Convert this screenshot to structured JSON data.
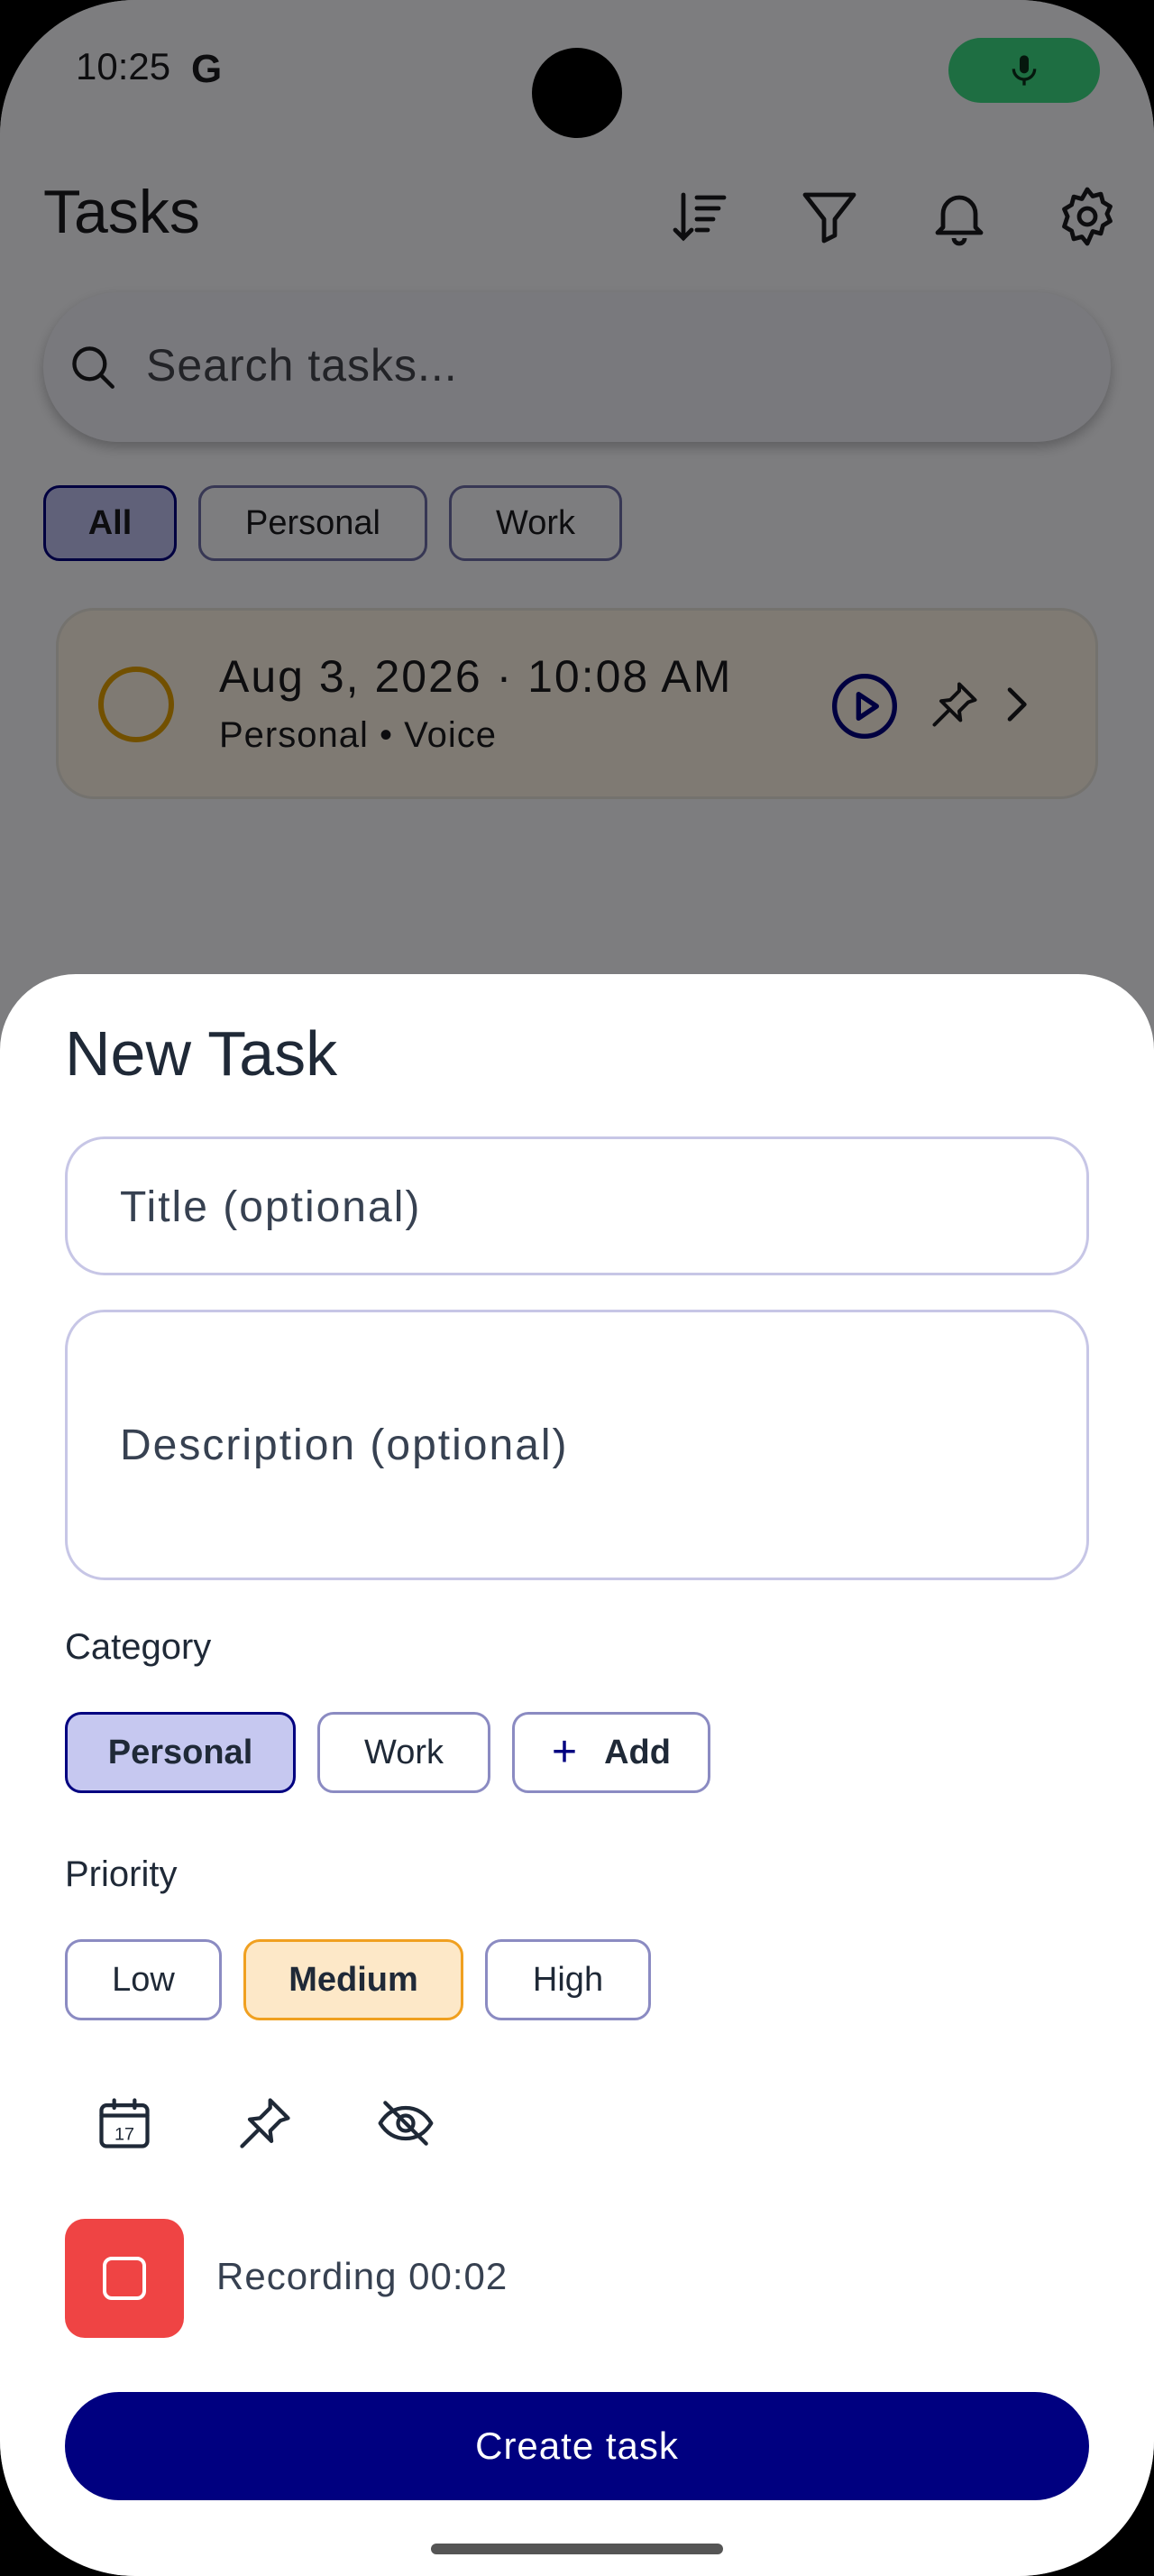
{
  "status_bar": {
    "time": "10:25",
    "g_label": "G"
  },
  "app_bar": {
    "title": "Tasks",
    "icons": [
      "sort-icon",
      "filter-icon",
      "bell-icon",
      "settings-icon"
    ]
  },
  "search": {
    "placeholder": "Search tasks..."
  },
  "filters": [
    {
      "label": "All",
      "selected": true
    },
    {
      "label": "Personal",
      "selected": false
    },
    {
      "label": "Work",
      "selected": false
    }
  ],
  "task": {
    "title": "Aug 3, 2026 · 10:08 AM",
    "meta": "Personal • Voice"
  },
  "sheet": {
    "heading": "New Task",
    "title_placeholder": "Title (optional)",
    "description_placeholder": "Description (optional)",
    "category_label": "Category",
    "categories": [
      {
        "label": "Personal",
        "selected": true
      },
      {
        "label": "Work",
        "selected": false
      }
    ],
    "add_label": "Add",
    "priority_label": "Priority",
    "priorities": [
      {
        "label": "Low",
        "selected": false
      },
      {
        "label": "Medium",
        "selected": true
      },
      {
        "label": "High",
        "selected": false
      }
    ],
    "tools": [
      "calendar-icon",
      "pin-icon",
      "eye-off-icon"
    ],
    "calendar_day": "17",
    "recording_text": "Recording 00:02",
    "create_label": "Create task"
  },
  "colors": {
    "primary": "#000080",
    "record": "#ef4444",
    "priority_medium": "#f0a020",
    "mic_active": "#3ddc84"
  }
}
